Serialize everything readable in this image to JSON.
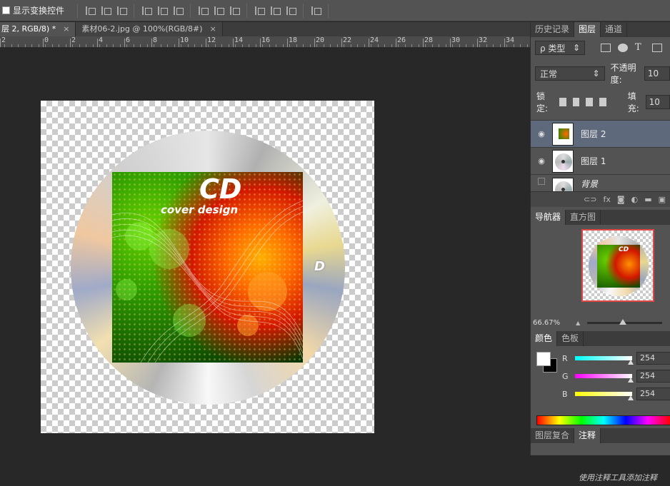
{
  "options_bar": {
    "show_transform_label": "显示变换控件"
  },
  "tabs": [
    {
      "label": "层 2, RGB/8) *",
      "close": "×"
    },
    {
      "label": "素材06-2.jpg @ 100%(RGB/8#)",
      "close": "×"
    }
  ],
  "ruler": {
    "ticks": [
      "2",
      "0",
      "2",
      "4",
      "6",
      "8",
      "10",
      "12",
      "14",
      "16",
      "18",
      "20",
      "22",
      "24",
      "26",
      "28",
      "30",
      "32",
      "34"
    ]
  },
  "artwork": {
    "cd_title": "CD",
    "cd_subtitle": "cover design",
    "disc_logo": "D"
  },
  "layers_panel": {
    "tabs": [
      "历史记录",
      "图层",
      "通道"
    ],
    "filter_label": "ρ 类型",
    "blend_mode": "正常",
    "opacity_label": "不透明度:",
    "opacity_value": "10",
    "lock_label": "锁定:",
    "fill_label": "填充:",
    "fill_value": "10",
    "layers": [
      {
        "name": "图层 2",
        "selected": true
      },
      {
        "name": "图层 1",
        "selected": false
      },
      {
        "name": "背景",
        "selected": false
      }
    ],
    "footer_icons": [
      "link-icon",
      "fx-icon",
      "mask-icon",
      "adjustment-icon",
      "folder-icon",
      "new-layer-icon"
    ]
  },
  "navigator_panel": {
    "tabs": [
      "导航器",
      "直方图"
    ],
    "zoom": "66.67%"
  },
  "color_panel": {
    "tabs": [
      "颜色",
      "色板"
    ],
    "channels": [
      {
        "label": "R",
        "value": "254"
      },
      {
        "label": "G",
        "value": "254"
      },
      {
        "label": "B",
        "value": "254"
      }
    ],
    "colors": {
      "foreground": "#fefefe",
      "background": "#000000"
    }
  },
  "notes_panel": {
    "tabs": [
      "图层复合",
      "注释"
    ],
    "hint": "使用注释工具添加注释"
  }
}
